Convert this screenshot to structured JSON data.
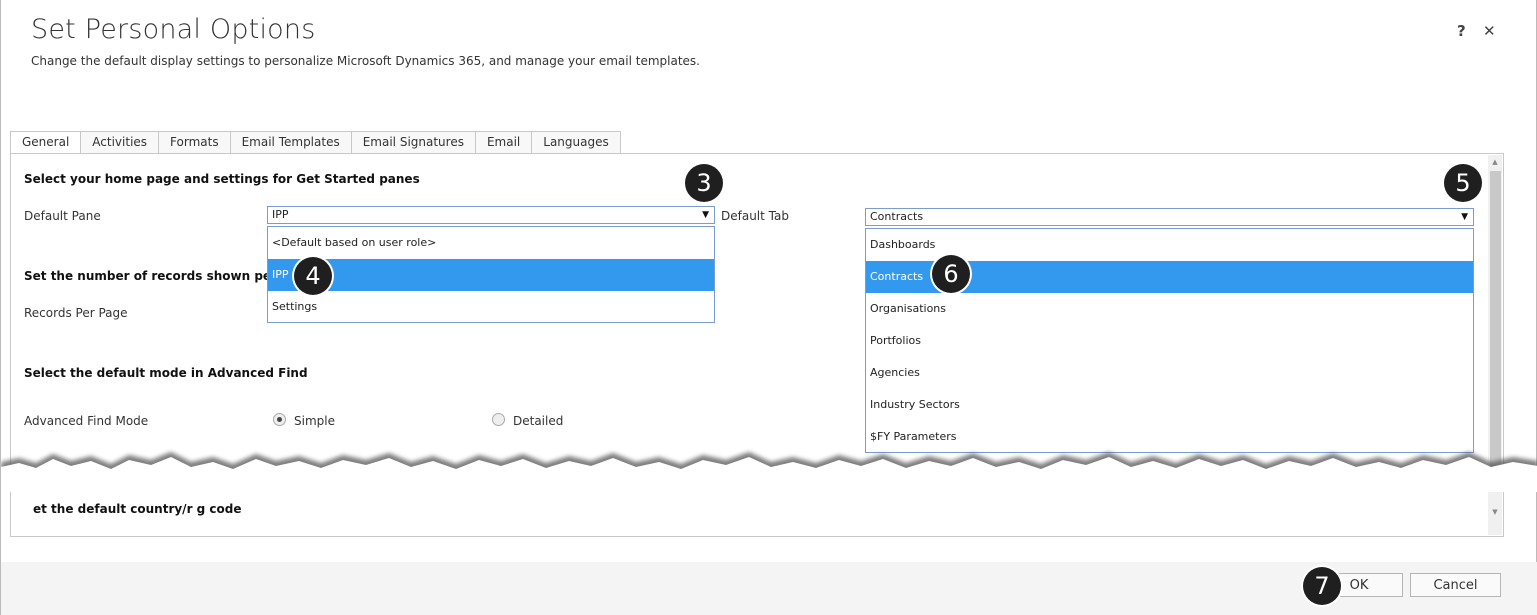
{
  "dialog": {
    "title": "Set Personal Options",
    "subtitle": "Change the default display settings to personalize Microsoft Dynamics 365, and manage your email templates.",
    "help_label": "?",
    "close_label": "✕"
  },
  "tabs": [
    {
      "label": "General",
      "active": true
    },
    {
      "label": "Activities"
    },
    {
      "label": "Formats"
    },
    {
      "label": "Email Templates"
    },
    {
      "label": "Email Signatures"
    },
    {
      "label": "Email"
    },
    {
      "label": "Languages"
    }
  ],
  "general": {
    "home_section": "Select your home page and settings for Get Started panes",
    "default_pane_label": "Default Pane",
    "default_pane_value": "IPP",
    "default_pane_options": [
      "<Default based on user role>",
      "IPP",
      "Settings"
    ],
    "default_tab_label": "Default Tab",
    "default_tab_value": "Contracts",
    "default_tab_options": [
      "Dashboards",
      "Contracts",
      "Organisations",
      "Portfolios",
      "Agencies",
      "Industry Sectors",
      "$FY Parameters"
    ],
    "records_section": "Set the number of records shown per page",
    "records_label": "Records Per Page",
    "advfind_section": "Select the default mode in Advanced Find",
    "advfind_label": "Advanced Find Mode",
    "advfind_simple": "Simple",
    "advfind_detailed": "Detailed",
    "country_section": "et the default country/r   g    code"
  },
  "callouts": [
    "3",
    "4",
    "5",
    "6",
    "7"
  ],
  "footer": {
    "ok_label": "OK",
    "cancel_label": "Cancel"
  },
  "arrow_glyph": "▼",
  "colors": {
    "selected_option": "#3399ee",
    "callout": "#1f1f1f"
  }
}
